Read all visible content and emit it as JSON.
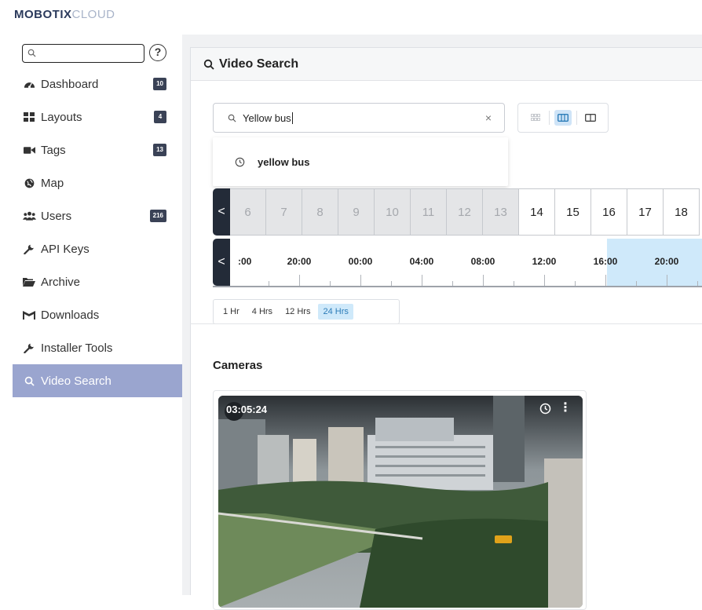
{
  "brand": {
    "part1": "MOBOTIX",
    "part2": "CLOUD"
  },
  "sidebar": {
    "search_placeholder": "",
    "help": "?",
    "items": [
      {
        "label": "Dashboard",
        "icon": "dashboard-icon",
        "badge": "10"
      },
      {
        "label": "Layouts",
        "icon": "grid-icon",
        "badge": "4"
      },
      {
        "label": "Tags",
        "icon": "video-camera-icon",
        "badge": "13"
      },
      {
        "label": "Map",
        "icon": "globe-icon",
        "badge": ""
      },
      {
        "label": "Users",
        "icon": "users-icon",
        "badge": "216"
      },
      {
        "label": "API Keys",
        "icon": "wrench-icon",
        "badge": ""
      },
      {
        "label": "Archive",
        "icon": "folder-open-icon",
        "badge": ""
      },
      {
        "label": "Downloads",
        "icon": "film-icon",
        "badge": ""
      },
      {
        "label": "Installer Tools",
        "icon": "wrench-icon",
        "badge": ""
      },
      {
        "label": "Video Search",
        "icon": "search-icon",
        "badge": "",
        "active": true
      }
    ]
  },
  "main": {
    "title": "Video Search",
    "search": {
      "value": "Yellow bus",
      "clear": "×"
    },
    "suggestion": "yellow bus",
    "days": {
      "prev": "<",
      "list": [
        {
          "d": "6",
          "past": true
        },
        {
          "d": "7",
          "past": true
        },
        {
          "d": "8",
          "past": true
        },
        {
          "d": "9",
          "past": true
        },
        {
          "d": "10",
          "past": true
        },
        {
          "d": "11",
          "past": true
        },
        {
          "d": "12",
          "past": true
        },
        {
          "d": "13",
          "past": true
        },
        {
          "d": "14",
          "past": false
        },
        {
          "d": "15",
          "past": false
        },
        {
          "d": "16",
          "past": false
        },
        {
          "d": "17",
          "past": false
        },
        {
          "d": "18",
          "past": false
        }
      ]
    },
    "times": {
      "prev": "<",
      "labels": [
        ":00",
        "20:00",
        "00:00",
        "04:00",
        "08:00",
        "12:00",
        "16:00",
        "20:00"
      ]
    },
    "ranges": [
      {
        "label": "1 Hr",
        "selected": false
      },
      {
        "label": "4 Hrs",
        "selected": false
      },
      {
        "label": "12 Hrs",
        "selected": false
      },
      {
        "label": "24 Hrs",
        "selected": true
      }
    ],
    "cameras_title": "Cameras",
    "camera": {
      "timestamp": "03:05:24",
      "menu": "⋮"
    }
  },
  "colors": {
    "active_nav": "#9aa5cf",
    "nav_arrow": "#232b38",
    "highlight": "#cfe9fa",
    "badge": "#3a4256"
  }
}
